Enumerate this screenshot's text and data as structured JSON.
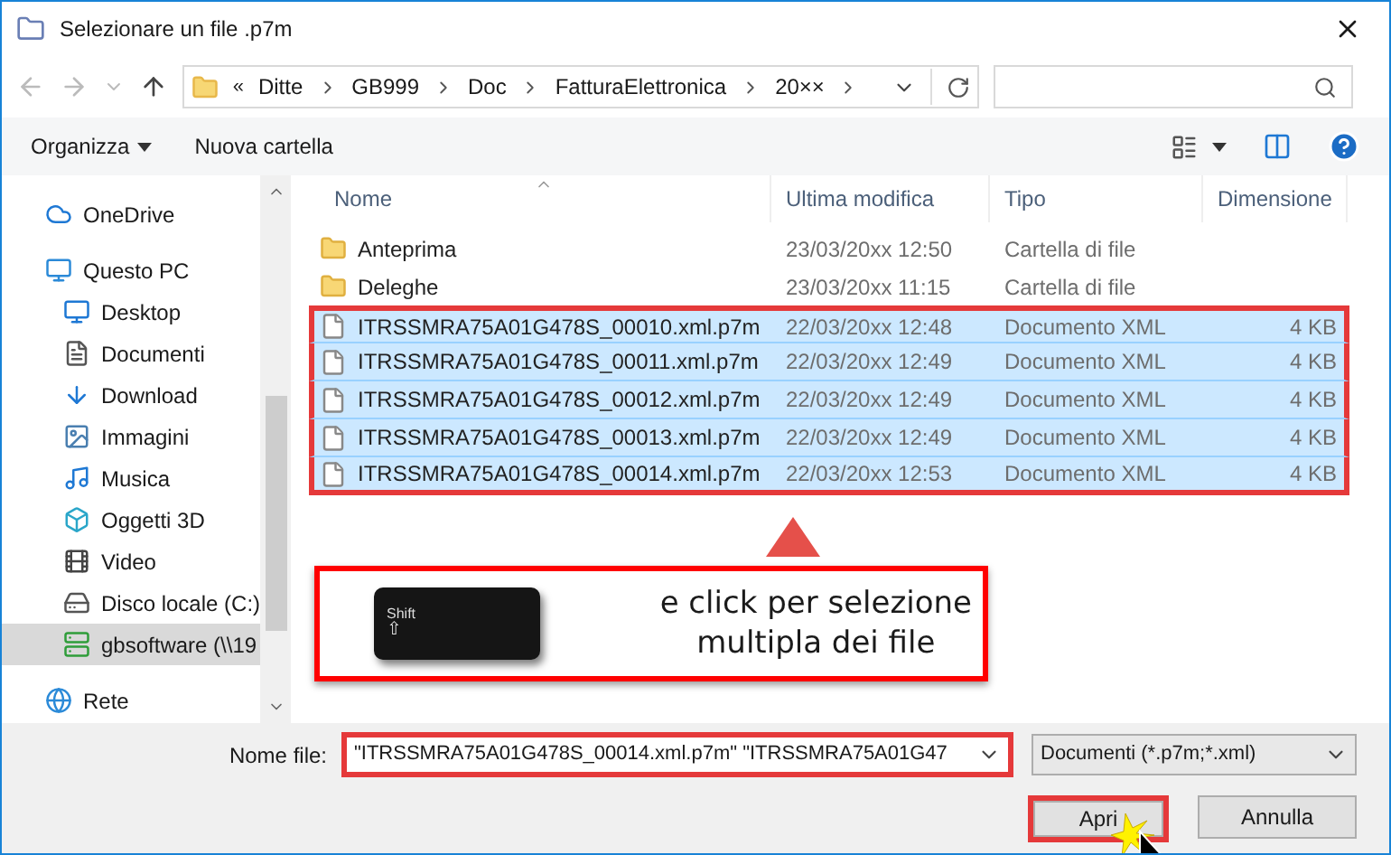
{
  "window": {
    "title": "Selezionare un file .p7m"
  },
  "breadcrumb": {
    "overflow": "«",
    "parts": [
      "Ditte",
      "GB999",
      "Doc",
      "FatturaElettronica",
      "20××"
    ]
  },
  "toolbar": {
    "organize": "Organizza",
    "new_folder": "Nuova cartella"
  },
  "sidebar": {
    "items": [
      {
        "label": "OneDrive",
        "selected": false
      },
      {
        "label": "Questo PC",
        "selected": false,
        "children": [
          {
            "label": "Desktop",
            "selected": false
          },
          {
            "label": "Documenti",
            "selected": false
          },
          {
            "label": "Download",
            "selected": false
          },
          {
            "label": "Immagini",
            "selected": false
          },
          {
            "label": "Musica",
            "selected": false
          },
          {
            "label": "Oggetti 3D",
            "selected": false
          },
          {
            "label": "Video",
            "selected": false
          },
          {
            "label": "Disco locale (C:)",
            "selected": false
          },
          {
            "label": "gbsoftware (\\\\19",
            "selected": true
          }
        ]
      },
      {
        "label": "Rete",
        "selected": false
      }
    ]
  },
  "table": {
    "columns": [
      "Nome",
      "Ultima modifica",
      "Tipo",
      "Dimensione"
    ],
    "rows": [
      {
        "kind": "folder",
        "name": "Anteprima",
        "modified": "23/03/20xx 12:50",
        "type": "Cartella di file",
        "selected": false
      },
      {
        "kind": "folder",
        "name": "Deleghe",
        "modified": "23/03/20xx 11:15",
        "type": "Cartella di file",
        "selected": false
      },
      {
        "kind": "file",
        "name": "ITRSSMRA75A01G478S_00010.xml.p7m",
        "modified": "22/03/20xx 12:48",
        "type": "Documento XML",
        "size": "4 KB",
        "selected": true
      },
      {
        "kind": "file",
        "name": "ITRSSMRA75A01G478S_00011.xml.p7m",
        "modified": "22/03/20xx 12:49",
        "type": "Documento XML",
        "size": "4 KB",
        "selected": true
      },
      {
        "kind": "file",
        "name": "ITRSSMRA75A01G478S_00012.xml.p7m",
        "modified": "22/03/20xx 12:49",
        "type": "Documento XML",
        "size": "4 KB",
        "selected": true
      },
      {
        "kind": "file",
        "name": "ITRSSMRA75A01G478S_00013.xml.p7m",
        "modified": "22/03/20xx 12:49",
        "type": "Documento XML",
        "size": "4 KB",
        "selected": true
      },
      {
        "kind": "file",
        "name": "ITRSSMRA75A01G478S_00014.xml.p7m",
        "modified": "22/03/20xx 12:53",
        "type": "Documento XML",
        "size": "4 KB",
        "selected": true
      }
    ]
  },
  "annotation": {
    "key_label": "Shift",
    "key_symbol": "⇧",
    "text_lines": [
      "e click per selezione",
      "multipla dei file"
    ]
  },
  "footer": {
    "filename_label": "Nome file:",
    "filename_value": "\"ITRSSMRA75A01G478S_00014.xml.p7m\" \"ITRSSMRA75A01G47",
    "filter": "Documenti (*.p7m;*.xml)",
    "open": "Apri",
    "cancel": "Annulla"
  }
}
